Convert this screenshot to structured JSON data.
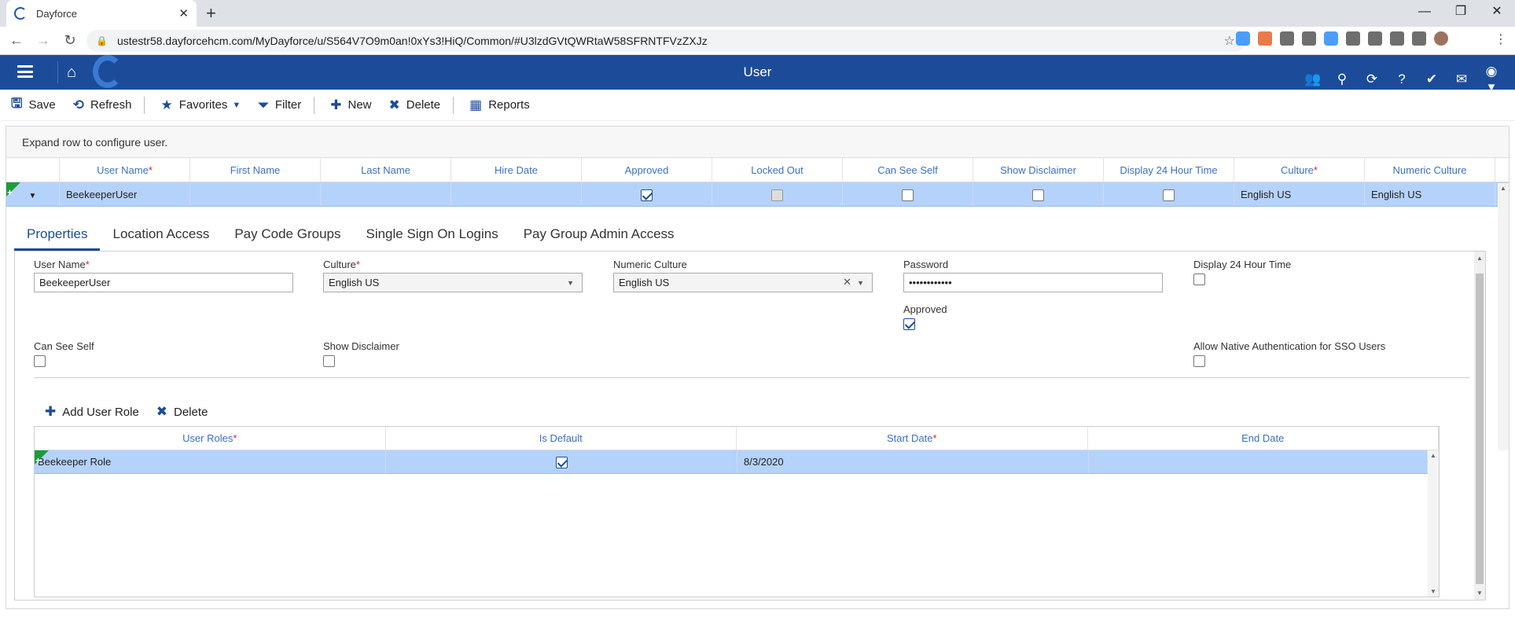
{
  "browser": {
    "tab_title": "Dayforce",
    "url": "ustestr58.dayforcehcm.com/MyDayforce/u/S564V7O9m0an!0xYs3!HiQ/Common/#U3lzdGVtQWRtaW58SFRNTFVzZXJz"
  },
  "app": {
    "title": "User"
  },
  "toolbar": {
    "save": "Save",
    "refresh": "Refresh",
    "favorites": "Favorites",
    "filter": "Filter",
    "new": "New",
    "delete": "Delete",
    "reports": "Reports"
  },
  "hint": "Expand row to configure user.",
  "user_grid": {
    "columns": [
      "User Name",
      "First Name",
      "Last Name",
      "Hire Date",
      "Approved",
      "Locked Out",
      "Can See Self",
      "Show Disclaimer",
      "Display 24 Hour Time",
      "Culture",
      "Numeric Culture"
    ],
    "row": {
      "user_name": "BeekeeperUser",
      "first_name": "",
      "last_name": "",
      "hire_date": "",
      "culture": "English US",
      "numeric_culture": "English US"
    }
  },
  "tabs": [
    "Properties",
    "Location Access",
    "Pay Code Groups",
    "Single Sign On Logins",
    "Pay Group Admin Access"
  ],
  "properties": {
    "user_name_label": "User Name",
    "user_name_value": "BeekeeperUser",
    "culture_label": "Culture",
    "culture_value": "English US",
    "numeric_culture_label": "Numeric Culture",
    "numeric_culture_value": "English US",
    "password_label": "Password",
    "password_value": "••••••••••••",
    "display24_label": "Display 24 Hour Time",
    "approved_label": "Approved",
    "can_see_self_label": "Can See Self",
    "show_disclaimer_label": "Show Disclaimer",
    "allow_native_label": "Allow Native Authentication for SSO Users"
  },
  "roles": {
    "add_label": "Add User Role",
    "delete_label": "Delete",
    "columns": [
      "User Roles",
      "Is Default",
      "Start Date",
      "End Date"
    ],
    "row": {
      "role": "Beekeeper Role",
      "start_date": "8/3/2020",
      "end_date": ""
    }
  }
}
